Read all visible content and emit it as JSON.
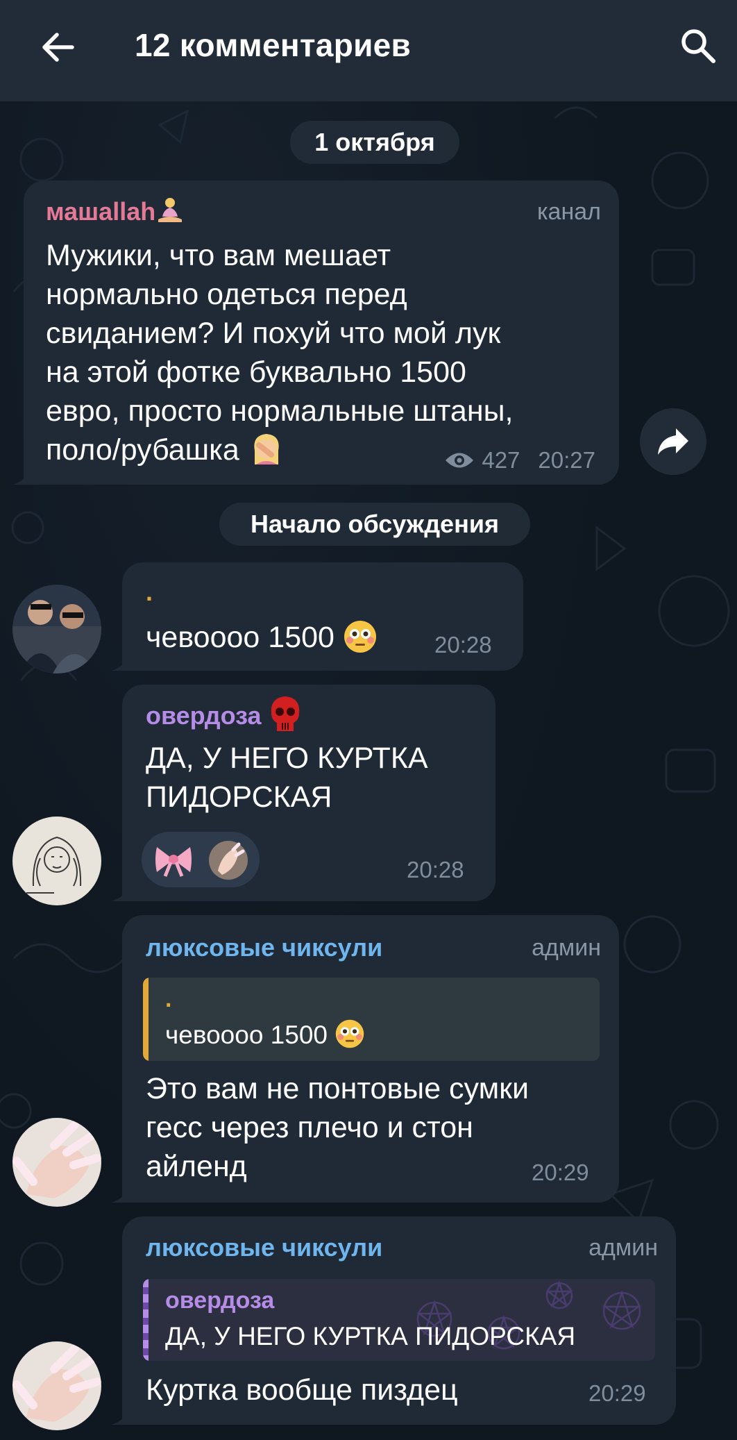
{
  "header": {
    "title": "12 комментариев",
    "back_icon": "arrow-left-icon",
    "search_icon": "search-icon"
  },
  "date_pill": "1 октября",
  "discussion_pill": "Начало обсуждения",
  "post": {
    "author": "машallah",
    "author_color": "#e57a96",
    "role": "канал",
    "text_lines": [
      "Мужики, что вам мешает",
      "нормально одеться перед",
      "свиданием? И похуй что мой лук",
      "на этой фотке буквально 1500",
      "евро, просто нормальные штаны,",
      "поло/рубашка"
    ],
    "views": "427",
    "time": "20:27"
  },
  "comments": [
    {
      "author": ".",
      "author_color": "#e0a93a",
      "text": "чевоооо 1500",
      "time": "20:28"
    },
    {
      "author": "овердоза",
      "author_color": "#b58ce6",
      "text_lines": [
        "ДА, У НЕГО КУРТКА",
        "ПИДОРСКАЯ"
      ],
      "time": "20:28"
    },
    {
      "author": "люксовые чиксули",
      "author_color": "#6fb5ee",
      "role": "админ",
      "quote_author": ".",
      "quote_author_color": "#e0a93a",
      "quote_text": "чевоооо 1500",
      "text_lines": [
        "Это вам не понтовые сумки",
        "гесс через плечо и стон",
        "айленд"
      ],
      "time": "20:29"
    },
    {
      "author": "люксовые чиксули",
      "author_color": "#6fb5ee",
      "role": "админ",
      "quote_author": "овердоза",
      "quote_author_color": "#b58ce6",
      "quote_text": "ДА, У НЕГО КУРТКА ПИДОРСКАЯ",
      "text": "Куртка вообще пиздец",
      "time": "20:29"
    }
  ],
  "colors": {
    "header_bg": "#222c38",
    "bubble_bg": "#1f2a36",
    "chat_bg": "#0f1720"
  }
}
